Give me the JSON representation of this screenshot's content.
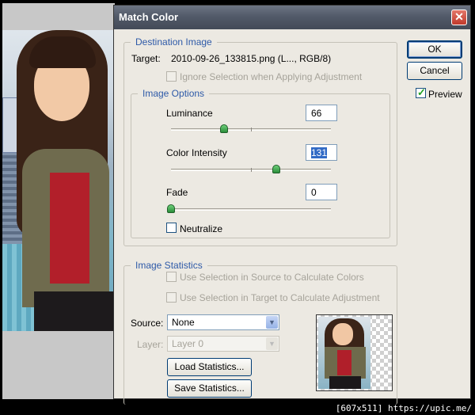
{
  "dialog": {
    "title": "Match Color",
    "close_glyph": "✕",
    "ok_label": "OK",
    "cancel_label": "Cancel",
    "preview_label": "Preview",
    "preview_checked": true
  },
  "destination": {
    "legend": "Destination Image",
    "target_label": "Target:",
    "target_value": "2010-09-26_133815.png (L..., RGB/8)",
    "ignore_selection_label": "Ignore Selection when Applying Adjustment"
  },
  "image_options": {
    "legend": "Image Options",
    "luminance_label": "Luminance",
    "luminance_value": "66",
    "luminance_level": 0.33,
    "intensity_label": "Color Intensity",
    "intensity_value": "131",
    "intensity_level": 0.66,
    "fade_label": "Fade",
    "fade_value": "0",
    "fade_level": 0.0,
    "neutralize_label": "Neutralize"
  },
  "image_statistics": {
    "legend": "Image Statistics",
    "use_source_label": "Use Selection in Source to Calculate Colors",
    "use_target_label": "Use Selection in Target to Calculate Adjustment",
    "source_label": "Source:",
    "source_value": "None",
    "layer_label": "Layer:",
    "layer_value": "Layer 0",
    "load_label": "Load Statistics...",
    "save_label": "Save Statistics..."
  },
  "watermark": "[607x511] https://upic.me/"
}
